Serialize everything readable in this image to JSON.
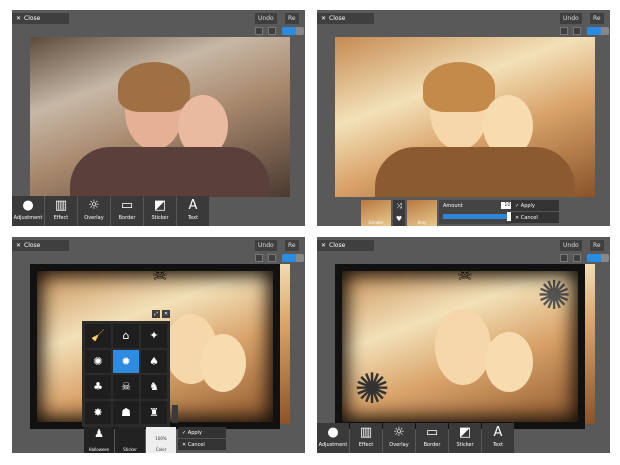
{
  "common": {
    "close_label": "Close",
    "undo_label": "Undo",
    "redo_label": "Re"
  },
  "toolbar": {
    "adjustment": "Adjustment",
    "effect": "Effect",
    "overlay": "Overlay",
    "border": "Border",
    "sticker": "Sticker",
    "text": "Text"
  },
  "effect_panel": {
    "thumb1": "Grinder",
    "thumb2": "Amy",
    "amount_label": "Amount",
    "amount_value": "100",
    "amount_fraction": 1.0,
    "apply": "Apply",
    "cancel": "Cancel"
  },
  "sticker_panel": {
    "category1": "Halloween",
    "category2": "Sticker",
    "opacity_value": "100%",
    "opacity_label": "Color",
    "apply": "Apply",
    "cancel": "Cancel"
  },
  "colors": {
    "accent": "#2e8be0",
    "panel_bg": "#595959",
    "bar_bg": "#3a3a3a"
  }
}
